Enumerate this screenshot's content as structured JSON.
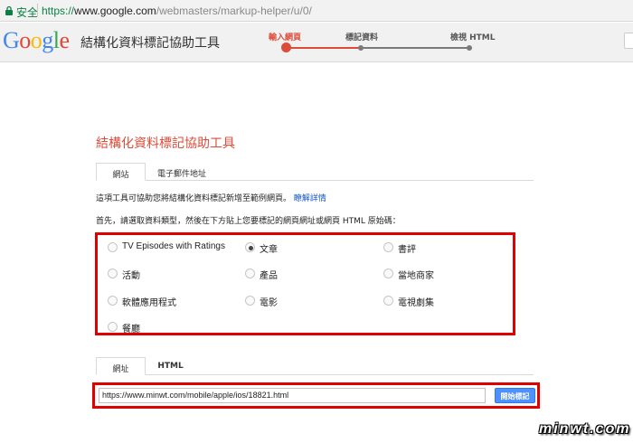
{
  "browser": {
    "secure_label": "安全",
    "url_scheme": "https://",
    "url_host": "www.google.com",
    "url_path": "/webmasters/markup-helper/u/0/"
  },
  "header": {
    "logo_text": "Google",
    "app_title": "結構化資料標記協助工具",
    "steps": [
      {
        "label": "輸入網頁",
        "active": true
      },
      {
        "label": "標記資料",
        "active": false
      },
      {
        "label": "檢視 HTML",
        "active": false
      }
    ],
    "accent_color": "#dd4b39"
  },
  "main": {
    "title": "結構化資料標記協助工具",
    "tabs": [
      {
        "label": "網站",
        "active": true
      },
      {
        "label": "電子郵件地址",
        "active": false
      }
    ],
    "description": "這項工具可協助您將結構化資料標記新增至範例網頁。",
    "learn_more": "瞭解詳情",
    "instruction": "首先，請選取資料類型，然後在下方貼上您要標記的網頁網址或網頁 HTML 原始碼：",
    "data_types": [
      {
        "label": "TV Episodes with Ratings",
        "selected": false
      },
      {
        "label": "文章",
        "selected": true
      },
      {
        "label": "書評",
        "selected": false
      },
      {
        "label": "活動",
        "selected": false
      },
      {
        "label": "產品",
        "selected": false
      },
      {
        "label": "當地商家",
        "selected": false
      },
      {
        "label": "軟體應用程式",
        "selected": false
      },
      {
        "label": "電影",
        "selected": false
      },
      {
        "label": "電視劇集",
        "selected": false
      },
      {
        "label": "餐廳",
        "selected": false
      }
    ],
    "source_tabs": [
      {
        "label": "網址",
        "active": true
      },
      {
        "label": "HTML",
        "active": false
      }
    ],
    "url_value": "https://www.minwt.com/mobile/apple/ios/18821.html",
    "start_button": "開始標記",
    "highlight_color": "#e00000",
    "button_color": "#4d90fe"
  },
  "watermark": "minwt.com"
}
